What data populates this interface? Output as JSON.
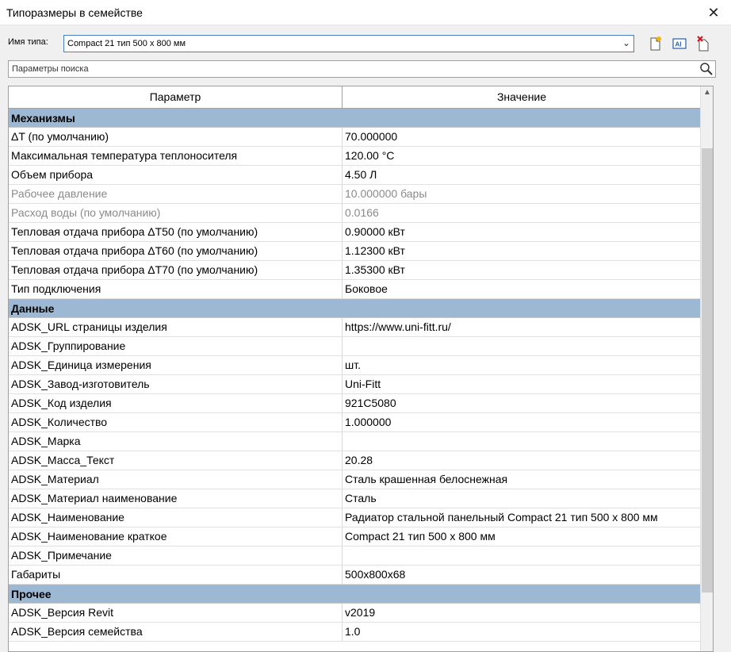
{
  "window": {
    "title": "Типоразмеры в семействе"
  },
  "type_row": {
    "label": "Имя типа:",
    "selected": "Compact 21 тип 500 x 800 мм"
  },
  "search": {
    "placeholder": "Параметры поиска"
  },
  "grid": {
    "col_param": "Параметр",
    "col_value": "Значение",
    "groups": [
      {
        "name": "Механизмы",
        "rows": [
          {
            "p": "ΔT (по умолчанию)",
            "v": "70.000000",
            "disabled": false
          },
          {
            "p": "Максимальная температура теплоносителя",
            "v": "120.00 °C",
            "disabled": false
          },
          {
            "p": "Объем прибора",
            "v": "4.50 Л",
            "disabled": false
          },
          {
            "p": "Рабочее давление",
            "v": "10.000000 бары",
            "disabled": true
          },
          {
            "p": "Расход воды (по умолчанию)",
            "v": "0.0166",
            "disabled": true
          },
          {
            "p": "Тепловая отдача прибора ΔT50 (по умолчанию)",
            "v": "0.90000 кВт",
            "disabled": false
          },
          {
            "p": "Тепловая отдача прибора ΔT60 (по умолчанию)",
            "v": "1.12300 кВт",
            "disabled": false
          },
          {
            "p": "Тепловая отдача прибора ΔT70 (по умолчанию)",
            "v": "1.35300 кВт",
            "disabled": false
          },
          {
            "p": "Тип подключения",
            "v": "Боковое",
            "disabled": false
          }
        ]
      },
      {
        "name": "Данные",
        "rows": [
          {
            "p": "ADSK_URL страницы изделия",
            "v": "https://www.uni-fitt.ru/",
            "disabled": false
          },
          {
            "p": "ADSK_Группирование",
            "v": "",
            "disabled": false
          },
          {
            "p": "ADSK_Единица измерения",
            "v": "шт.",
            "disabled": false
          },
          {
            "p": "ADSK_Завод-изготовитель",
            "v": "Uni-Fitt",
            "disabled": false
          },
          {
            "p": "ADSK_Код изделия",
            "v": "921C5080",
            "disabled": false
          },
          {
            "p": "ADSK_Количество",
            "v": "1.000000",
            "disabled": false
          },
          {
            "p": "ADSK_Марка",
            "v": "",
            "disabled": false
          },
          {
            "p": "ADSK_Масса_Текст",
            "v": "20.28",
            "disabled": false
          },
          {
            "p": "ADSK_Материал",
            "v": "Сталь крашенная белоснежная",
            "disabled": false
          },
          {
            "p": "ADSK_Материал наименование",
            "v": "Сталь",
            "disabled": false
          },
          {
            "p": "ADSK_Наименование",
            "v": "Радиатор стальной панельный Compact 21 тип 500 x 800 мм",
            "disabled": false
          },
          {
            "p": "ADSK_Наименование краткое",
            "v": "Compact 21 тип 500 x 800 мм",
            "disabled": false
          },
          {
            "p": "ADSK_Примечание",
            "v": "",
            "disabled": false
          },
          {
            "p": "Габариты",
            "v": "500x800x68",
            "disabled": false
          }
        ]
      },
      {
        "name": "Прочее",
        "rows": [
          {
            "p": "ADSK_Версия Revit",
            "v": "v2019",
            "disabled": false
          },
          {
            "p": "ADSK_Версия семейства",
            "v": "1.0",
            "disabled": false
          }
        ]
      }
    ]
  },
  "icons": {
    "close": "close-icon",
    "new_type": "new-type-icon",
    "rename_type": "rename-type-icon",
    "delete_type": "delete-type-icon",
    "search": "magnifier-icon",
    "dropdown": "chevron-down-icon"
  },
  "colors": {
    "group_header": "#9db8d3",
    "select_border": "#4a7fc1"
  }
}
